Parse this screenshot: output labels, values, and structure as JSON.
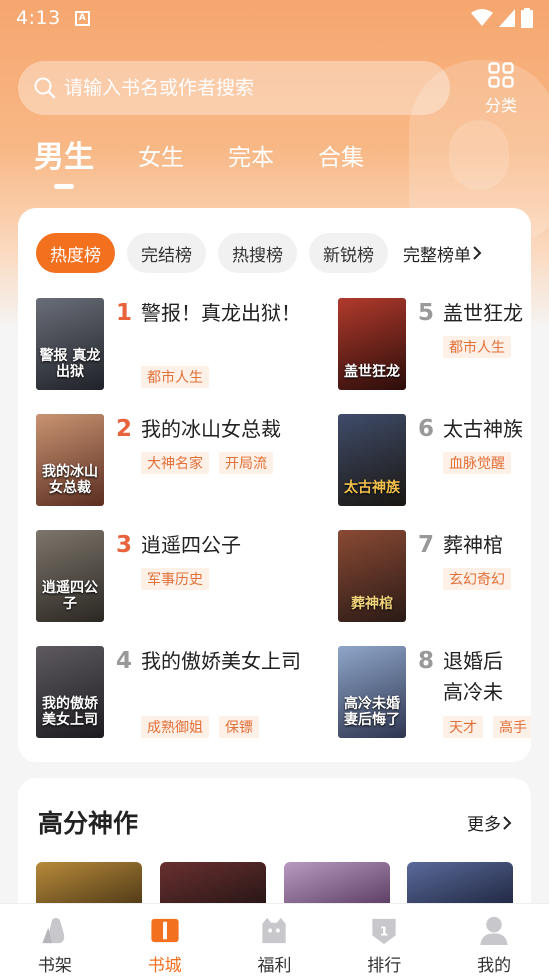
{
  "status_bar": {
    "time": "4:13"
  },
  "search": {
    "placeholder": "请输入书名或作者搜索"
  },
  "category": {
    "label": "分类"
  },
  "tabs": [
    {
      "label": "男生",
      "active": true
    },
    {
      "label": "女生"
    },
    {
      "label": "完本"
    },
    {
      "label": "合集"
    }
  ],
  "ranking": {
    "chips": [
      "热度榜",
      "完结榜",
      "热搜榜",
      "新锐榜"
    ],
    "full_list": "完整榜单",
    "items": [
      {
        "rank": "1",
        "title": "警报！真龙出狱！",
        "tags": [
          "都市人生"
        ],
        "cover_text": "警报 真龙出狱",
        "rank_color": "#e8623c"
      },
      {
        "rank": "2",
        "title": "我的冰山女总裁",
        "tags": [
          "大神名家",
          "开局流"
        ],
        "cover_text": "我的冰山女总裁",
        "rank_color": "#e8623c"
      },
      {
        "rank": "3",
        "title": "逍遥四公子",
        "tags": [
          "军事历史"
        ],
        "cover_text": "逍遥四公子",
        "rank_color": "#e8623c"
      },
      {
        "rank": "4",
        "title": "我的傲娇美女上司",
        "tags": [
          "成熟御姐",
          "保镖"
        ],
        "cover_text": "我的傲娇美女上司",
        "rank_color": "#999999"
      },
      {
        "rank": "5",
        "title": "盖世狂龙",
        "tags": [
          "都市人生"
        ],
        "cover_text": "盖世狂龙",
        "rank_color": "#999999"
      },
      {
        "rank": "6",
        "title": "太古神族",
        "tags": [
          "血脉觉醒"
        ],
        "cover_text": "太古神族",
        "rank_color": "#999999"
      },
      {
        "rank": "7",
        "title": "葬神棺",
        "tags": [
          "玄幻奇幻"
        ],
        "cover_text": "葬神棺",
        "rank_color": "#999999"
      },
      {
        "rank": "8",
        "title": "退婚后高冷未婚妻后悔了",
        "tags": [
          "天才",
          "高手"
        ],
        "cover_text": "高冷未婚妻后悔了",
        "rank_color": "#999999"
      }
    ]
  },
  "high_score": {
    "title": "高分神作",
    "more": "更多"
  },
  "nav": [
    {
      "label": "书架",
      "icon": "bookshelf-icon"
    },
    {
      "label": "书城",
      "icon": "bookstore-icon",
      "active": true
    },
    {
      "label": "福利",
      "icon": "gift-icon"
    },
    {
      "label": "排行",
      "icon": "rank-icon"
    },
    {
      "label": "我的",
      "icon": "profile-icon"
    }
  ],
  "colors": {
    "accent": "#f3701f",
    "header_top": "#f6a66f"
  }
}
